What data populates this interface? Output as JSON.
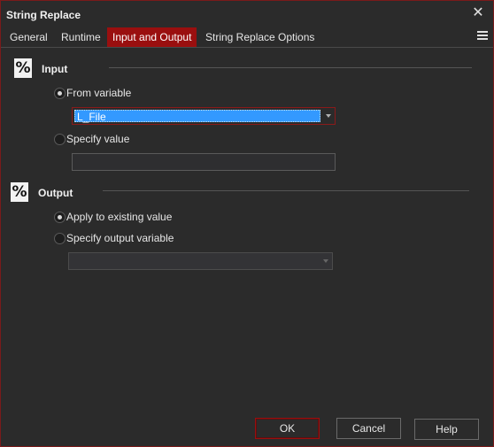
{
  "window": {
    "title": "String Replace",
    "close_glyph": "✕"
  },
  "tabs": [
    {
      "label": "General",
      "active": false
    },
    {
      "label": "Runtime",
      "active": false
    },
    {
      "label": "Input and Output",
      "active": true
    },
    {
      "label": "String Replace Options",
      "active": false
    }
  ],
  "input": {
    "icon_glyph": "%",
    "title": "Input",
    "from_variable_label": "From variable",
    "from_variable_selected": true,
    "variable_value": "L_File",
    "specify_value_label": "Specify value",
    "specify_value_text": ""
  },
  "output": {
    "icon_glyph": "%",
    "title": "Output",
    "apply_existing_label": "Apply to existing value",
    "apply_existing_selected": true,
    "specify_output_label": "Specify output variable",
    "output_variable_value": ""
  },
  "buttons": {
    "ok": "OK",
    "cancel": "Cancel",
    "help": "Help"
  },
  "colors": {
    "accent": "#9a0f0f",
    "selection": "#3399ff"
  }
}
